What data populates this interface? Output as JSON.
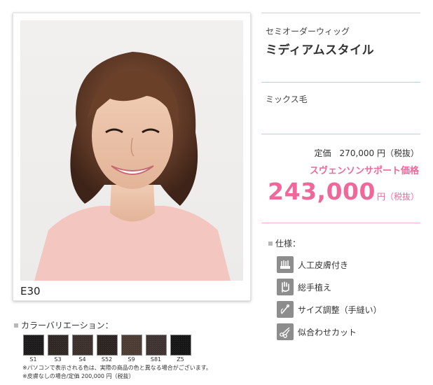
{
  "photo": {
    "caption": "E30"
  },
  "product": {
    "category": "セミオーダーウィッグ",
    "name": "ミディアムスタイル",
    "material": "ミックス毛"
  },
  "price": {
    "list_label": "定価",
    "list_amount": "270,000 円（税抜）",
    "support_label": "スヴェンソンサポート価格",
    "sale_amount": "243,000",
    "sale_unit": "円（税抜）"
  },
  "specs": {
    "title": "仕様：",
    "items": [
      {
        "label": "人工皮膚付き",
        "icon": "artificial-skin-icon"
      },
      {
        "label": "総手植え",
        "icon": "hand-icon"
      },
      {
        "label": "サイズ調整（手縫い）",
        "icon": "needle-icon"
      },
      {
        "label": "似合わせカット",
        "icon": "scissors-icon"
      }
    ]
  },
  "colors": {
    "title": "カラーバリエーション：",
    "swatches": [
      {
        "code": "S1",
        "color": "#1c1a19"
      },
      {
        "code": "S3",
        "color": "#2e2622"
      },
      {
        "code": "S4",
        "color": "#3a2f2a"
      },
      {
        "code": "S52",
        "color": "#2a2320"
      },
      {
        "code": "S9",
        "color": "#4a3a31"
      },
      {
        "code": "S81",
        "color": "#3d3230"
      },
      {
        "code": "Z5",
        "color": "#151414"
      }
    ]
  },
  "notes": {
    "line1": "※パソコンで表示される色は、実際の商品の色と異なる場合がございます。",
    "line2": "※皮膚なしの場合/定価 200,000 円（税抜）"
  },
  "theme": {
    "accent": "#f0689a",
    "rule": "#f3b6cb",
    "icon_bg": "#8d8d8d"
  }
}
